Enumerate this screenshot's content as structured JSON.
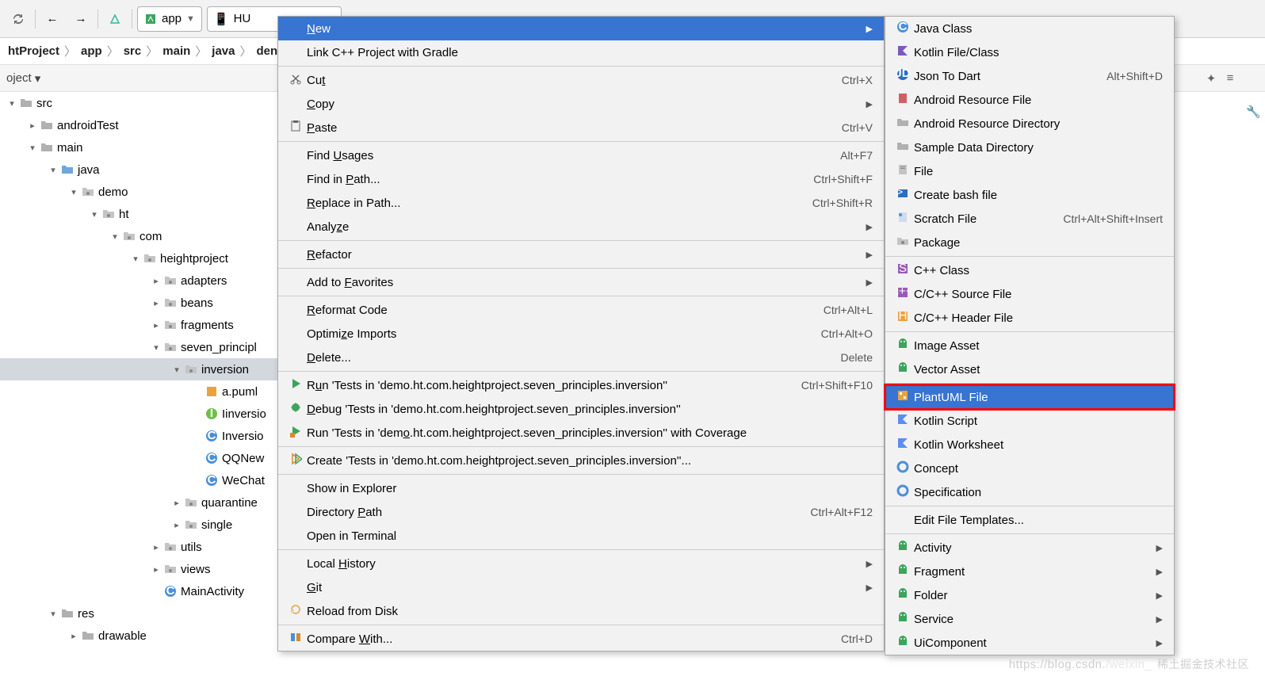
{
  "toolbar": {
    "module": "app",
    "device": "HU"
  },
  "breadcrumb": [
    "htProject",
    "app",
    "src",
    "main",
    "java",
    "den"
  ],
  "proj_header": {
    "label": "oject",
    "dd": "▾"
  },
  "tree": [
    {
      "ind": 0,
      "tw": "▾",
      "ico": "fold-grey",
      "lbl": "src"
    },
    {
      "ind": 1,
      "tw": "▸",
      "ico": "fold-grey",
      "lbl": "androidTest"
    },
    {
      "ind": 1,
      "tw": "▾",
      "ico": "fold-grey",
      "lbl": "main"
    },
    {
      "ind": 2,
      "tw": "▾",
      "ico": "fold-blue",
      "lbl": "java"
    },
    {
      "ind": 3,
      "tw": "▾",
      "ico": "pkg",
      "lbl": "demo"
    },
    {
      "ind": 4,
      "tw": "▾",
      "ico": "pkg",
      "lbl": "ht"
    },
    {
      "ind": 5,
      "tw": "▾",
      "ico": "pkg",
      "lbl": "com"
    },
    {
      "ind": 6,
      "tw": "▾",
      "ico": "pkg",
      "lbl": "heightproject"
    },
    {
      "ind": 7,
      "tw": "▸",
      "ico": "pkg",
      "lbl": "adapters"
    },
    {
      "ind": 7,
      "tw": "▸",
      "ico": "pkg",
      "lbl": "beans"
    },
    {
      "ind": 7,
      "tw": "▸",
      "ico": "pkg",
      "lbl": "fragments"
    },
    {
      "ind": 7,
      "tw": "▾",
      "ico": "pkg",
      "lbl": "seven_principl"
    },
    {
      "ind": 8,
      "tw": "▾",
      "ico": "pkg",
      "lbl": "inversion",
      "sel": true
    },
    {
      "ind": 9,
      "tw": "",
      "ico": "puml",
      "lbl": "a.puml"
    },
    {
      "ind": 9,
      "tw": "",
      "ico": "intf",
      "lbl": "Iinversio"
    },
    {
      "ind": 9,
      "tw": "",
      "ico": "cls",
      "lbl": "Inversio"
    },
    {
      "ind": 9,
      "tw": "",
      "ico": "cls",
      "lbl": "QQNew"
    },
    {
      "ind": 9,
      "tw": "",
      "ico": "cls",
      "lbl": "WeChat"
    },
    {
      "ind": 8,
      "tw": "▸",
      "ico": "pkg",
      "lbl": "quarantine"
    },
    {
      "ind": 8,
      "tw": "▸",
      "ico": "pkg",
      "lbl": "single"
    },
    {
      "ind": 7,
      "tw": "▸",
      "ico": "pkg",
      "lbl": "utils"
    },
    {
      "ind": 7,
      "tw": "▸",
      "ico": "pkg",
      "lbl": "views"
    },
    {
      "ind": 7,
      "tw": "",
      "ico": "cls",
      "lbl": "MainActivity"
    },
    {
      "ind": 2,
      "tw": "▾",
      "ico": "fold-grey",
      "lbl": "res"
    },
    {
      "ind": 3,
      "tw": "▸",
      "ico": "fold-grey",
      "lbl": "drawable"
    }
  ],
  "ctx1": [
    {
      "type": "item",
      "ico": "",
      "raw": "New",
      "mnem": "N",
      "hl": true,
      "arr": true
    },
    {
      "type": "item",
      "ico": "",
      "raw": "Link C++ Project with Gradle"
    },
    {
      "type": "sep"
    },
    {
      "type": "item",
      "ico": "cut",
      "raw": "Cut",
      "mnem": "t",
      "sc": "Ctrl+X"
    },
    {
      "type": "item",
      "ico": "",
      "raw": "Copy",
      "mnem": "C",
      "arr": true
    },
    {
      "type": "item",
      "ico": "paste",
      "raw": "Paste",
      "mnem": "P",
      "sc": "Ctrl+V"
    },
    {
      "type": "sep"
    },
    {
      "type": "item",
      "ico": "",
      "raw": "Find Usages",
      "mnem": "U",
      "sc": "Alt+F7"
    },
    {
      "type": "item",
      "ico": "",
      "raw": "Find in Path...",
      "mnem": "P",
      "sc": "Ctrl+Shift+F"
    },
    {
      "type": "item",
      "ico": "",
      "raw": "Replace in Path...",
      "mnem": "R",
      "sc": "Ctrl+Shift+R"
    },
    {
      "type": "item",
      "ico": "",
      "raw": "Analyze",
      "mnem": "z",
      "arr": true
    },
    {
      "type": "sep"
    },
    {
      "type": "item",
      "ico": "",
      "raw": "Refactor",
      "mnem": "R",
      "arr": true
    },
    {
      "type": "sep"
    },
    {
      "type": "item",
      "ico": "",
      "raw": "Add to Favorites",
      "mnem": "F",
      "arr": true
    },
    {
      "type": "sep"
    },
    {
      "type": "item",
      "ico": "",
      "raw": "Reformat Code",
      "mnem": "R",
      "sc": "Ctrl+Alt+L"
    },
    {
      "type": "item",
      "ico": "",
      "raw": "Optimize Imports",
      "mnem": "z",
      "sc": "Ctrl+Alt+O"
    },
    {
      "type": "item",
      "ico": "",
      "raw": "Delete...",
      "mnem": "D",
      "sc": "Delete"
    },
    {
      "type": "sep"
    },
    {
      "type": "item",
      "ico": "run",
      "raw": "Run 'Tests in 'demo.ht.com.heightproject.seven_principles.inversion''",
      "mnem": "u",
      "sc": "Ctrl+Shift+F10"
    },
    {
      "type": "item",
      "ico": "debug",
      "raw": "Debug 'Tests in 'demo.ht.com.heightproject.seven_principles.inversion''",
      "mnem": "D"
    },
    {
      "type": "item",
      "ico": "cover",
      "raw": "Run 'Tests in 'demo.ht.com.heightproject.seven_principles.inversion'' with Coverage",
      "mnem": "o"
    },
    {
      "type": "sep"
    },
    {
      "type": "item",
      "ico": "create",
      "raw": "Create 'Tests in 'demo.ht.com.heightproject.seven_principles.inversion''..."
    },
    {
      "type": "sep"
    },
    {
      "type": "item",
      "ico": "",
      "raw": "Show in Explorer"
    },
    {
      "type": "item",
      "ico": "",
      "raw": "Directory Path",
      "mnem": "P",
      "sc": "Ctrl+Alt+F12"
    },
    {
      "type": "item",
      "ico": "",
      "raw": "Open in Terminal"
    },
    {
      "type": "sep"
    },
    {
      "type": "item",
      "ico": "",
      "raw": "Local History",
      "mnem": "H",
      "arr": true
    },
    {
      "type": "item",
      "ico": "",
      "raw": "Git",
      "mnem": "G",
      "arr": true
    },
    {
      "type": "item",
      "ico": "reload",
      "raw": "Reload from Disk"
    },
    {
      "type": "sep"
    },
    {
      "type": "item",
      "ico": "compare",
      "raw": "Compare With...",
      "mnem": "W",
      "sc": "Ctrl+D"
    }
  ],
  "ctx2": [
    {
      "type": "item",
      "ico": "cls-blue",
      "raw": "Java Class"
    },
    {
      "type": "item",
      "ico": "kt",
      "raw": "Kotlin File/Class"
    },
    {
      "type": "item",
      "ico": "json",
      "raw": "Json To Dart",
      "sc": "Alt+Shift+D"
    },
    {
      "type": "item",
      "ico": "xml",
      "raw": "Android Resource File"
    },
    {
      "type": "item",
      "ico": "dir",
      "raw": "Android Resource Directory"
    },
    {
      "type": "item",
      "ico": "dir",
      "raw": "Sample Data Directory"
    },
    {
      "type": "item",
      "ico": "file",
      "raw": "File"
    },
    {
      "type": "item",
      "ico": "bash",
      "raw": "Create bash file"
    },
    {
      "type": "item",
      "ico": "scratch",
      "raw": "Scratch File",
      "sc": "Ctrl+Alt+Shift+Insert"
    },
    {
      "type": "item",
      "ico": "pkg",
      "raw": "Package"
    },
    {
      "type": "sep"
    },
    {
      "type": "item",
      "ico": "cpp-s",
      "raw": "C++ Class"
    },
    {
      "type": "item",
      "ico": "cpp",
      "raw": "C/C++ Source File"
    },
    {
      "type": "item",
      "ico": "cpp-h",
      "raw": "C/C++ Header File"
    },
    {
      "type": "sep"
    },
    {
      "type": "item",
      "ico": "android",
      "raw": "Image Asset"
    },
    {
      "type": "item",
      "ico": "android",
      "raw": "Vector Asset"
    },
    {
      "type": "sep"
    },
    {
      "type": "item",
      "ico": "puml2",
      "raw": "PlantUML File",
      "hl": true,
      "box": true
    },
    {
      "type": "item",
      "ico": "kt2",
      "raw": "Kotlin Script"
    },
    {
      "type": "item",
      "ico": "kt2",
      "raw": "Kotlin Worksheet"
    },
    {
      "type": "item",
      "ico": "concept",
      "raw": "Concept"
    },
    {
      "type": "item",
      "ico": "concept",
      "raw": "Specification"
    },
    {
      "type": "sep"
    },
    {
      "type": "item",
      "ico": "",
      "raw": "Edit File Templates..."
    },
    {
      "type": "sep"
    },
    {
      "type": "item",
      "ico": "android",
      "raw": "Activity",
      "arr": true
    },
    {
      "type": "item",
      "ico": "android",
      "raw": "Fragment",
      "arr": true
    },
    {
      "type": "item",
      "ico": "android",
      "raw": "Folder",
      "arr": true
    },
    {
      "type": "item",
      "ico": "android",
      "raw": "Service",
      "arr": true
    },
    {
      "type": "item",
      "ico": "android",
      "raw": "UiComponent",
      "arr": true
    }
  ],
  "watermark": {
    "a": "https://blog.csdn.",
    "b": "/weixin_",
    "c": "稀土掘金技术社区"
  }
}
